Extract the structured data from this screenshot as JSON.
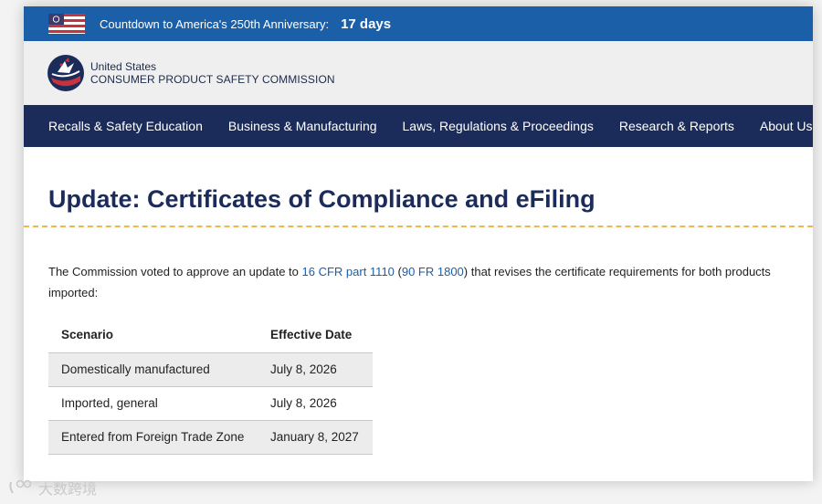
{
  "topbar": {
    "flag_icon": "us-flag-icon",
    "countdown_label": "Countdown to America's 250th Anniversary:",
    "countdown_value": "17 days",
    "bg_color": "#1a5fa8"
  },
  "header": {
    "logo_icon": "cpsc-eagle-logo",
    "agency_line1": "United States",
    "agency_line2": "CONSUMER PRODUCT SAFETY COMMISSION"
  },
  "nav": {
    "items": [
      {
        "label": "Recalls & Safety Education"
      },
      {
        "label": "Business & Manufacturing"
      },
      {
        "label": "Laws, Regulations & Proceedings"
      },
      {
        "label": "Research & Reports"
      },
      {
        "label": "About Us"
      }
    ],
    "bg_color": "#1b2c5b"
  },
  "main": {
    "title": "Update: Certificates of Compliance and eFiling",
    "intro_before": "The Commission voted to approve an update to ",
    "link1": "16 CFR part 1110",
    "intro_mid1": " (",
    "link2": "90 FR 1800",
    "intro_after": ") that revises the certificate requirements for both products",
    "intro_line2": "imported:",
    "table": {
      "headers": [
        "Scenario",
        "Effective Date"
      ],
      "rows": [
        [
          "Domestically manufactured",
          "July 8, 2026"
        ],
        [
          "Imported, general",
          "July 8, 2026"
        ],
        [
          "Entered from Foreign Trade Zone",
          "January 8, 2027"
        ]
      ]
    }
  },
  "watermark": {
    "text": "大数跨境"
  }
}
